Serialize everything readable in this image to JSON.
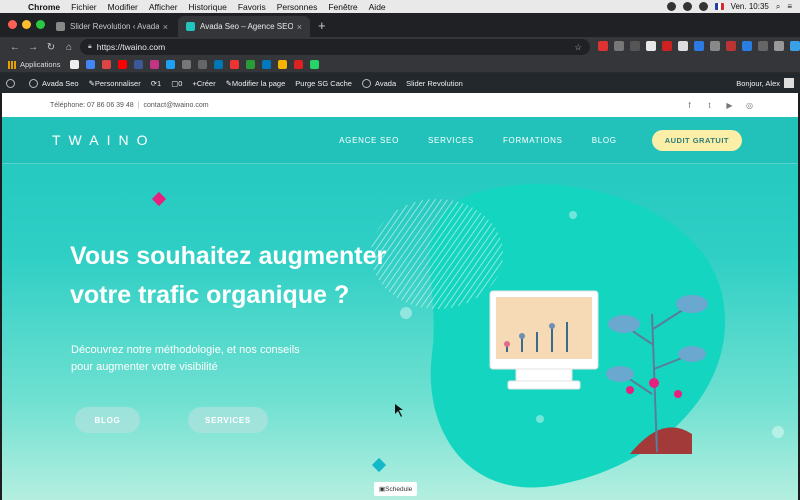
{
  "menubar": {
    "items": [
      "Chrome",
      "Fichier",
      "Modifier",
      "Afficher",
      "Historique",
      "Favoris",
      "Personnes",
      "Fenêtre",
      "Aide"
    ],
    "clock": "Ven. 10:35"
  },
  "tabs": [
    {
      "label": "Slider Revolution ‹ Avada Seo"
    },
    {
      "label": "Avada Seo – Agence SEO"
    }
  ],
  "address": {
    "url": "https://twaino.com"
  },
  "bookmarks": {
    "apps_label": "Applications"
  },
  "wpbar": {
    "items": [
      "Avada Seo",
      "Personnaliser",
      "1",
      "0",
      "Créer",
      "Modifier la page",
      "Purge SG Cache",
      "Avada",
      "Slider Revolution"
    ],
    "greeting": "Bonjour, Alex"
  },
  "topstrip": {
    "phone": "Téléphone: 07 86 06 39 48",
    "separator": "|",
    "email": "contact@twaino.com"
  },
  "site": {
    "logo": "TWAINO",
    "nav": [
      "AGENCE SEO",
      "SERVICES",
      "FORMATIONS",
      "BLOG"
    ],
    "cta": "AUDIT GRATUIT"
  },
  "hero": {
    "title_line1": "Vous souhaitez augmenter",
    "title_line2": "votre trafic organique ?",
    "sub_line1": "Découvrez notre méthodologie, et nos conseils",
    "sub_line2": "pour augmenter votre visibilité",
    "buttons": [
      "BLOG",
      "SERVICES"
    ]
  },
  "schedule_label": "Schedule",
  "colors": {
    "teal": "#22c2bb",
    "cta_bg": "#fbeea6",
    "blob": "#14d6c0",
    "accent_pink": "#e8207d"
  }
}
